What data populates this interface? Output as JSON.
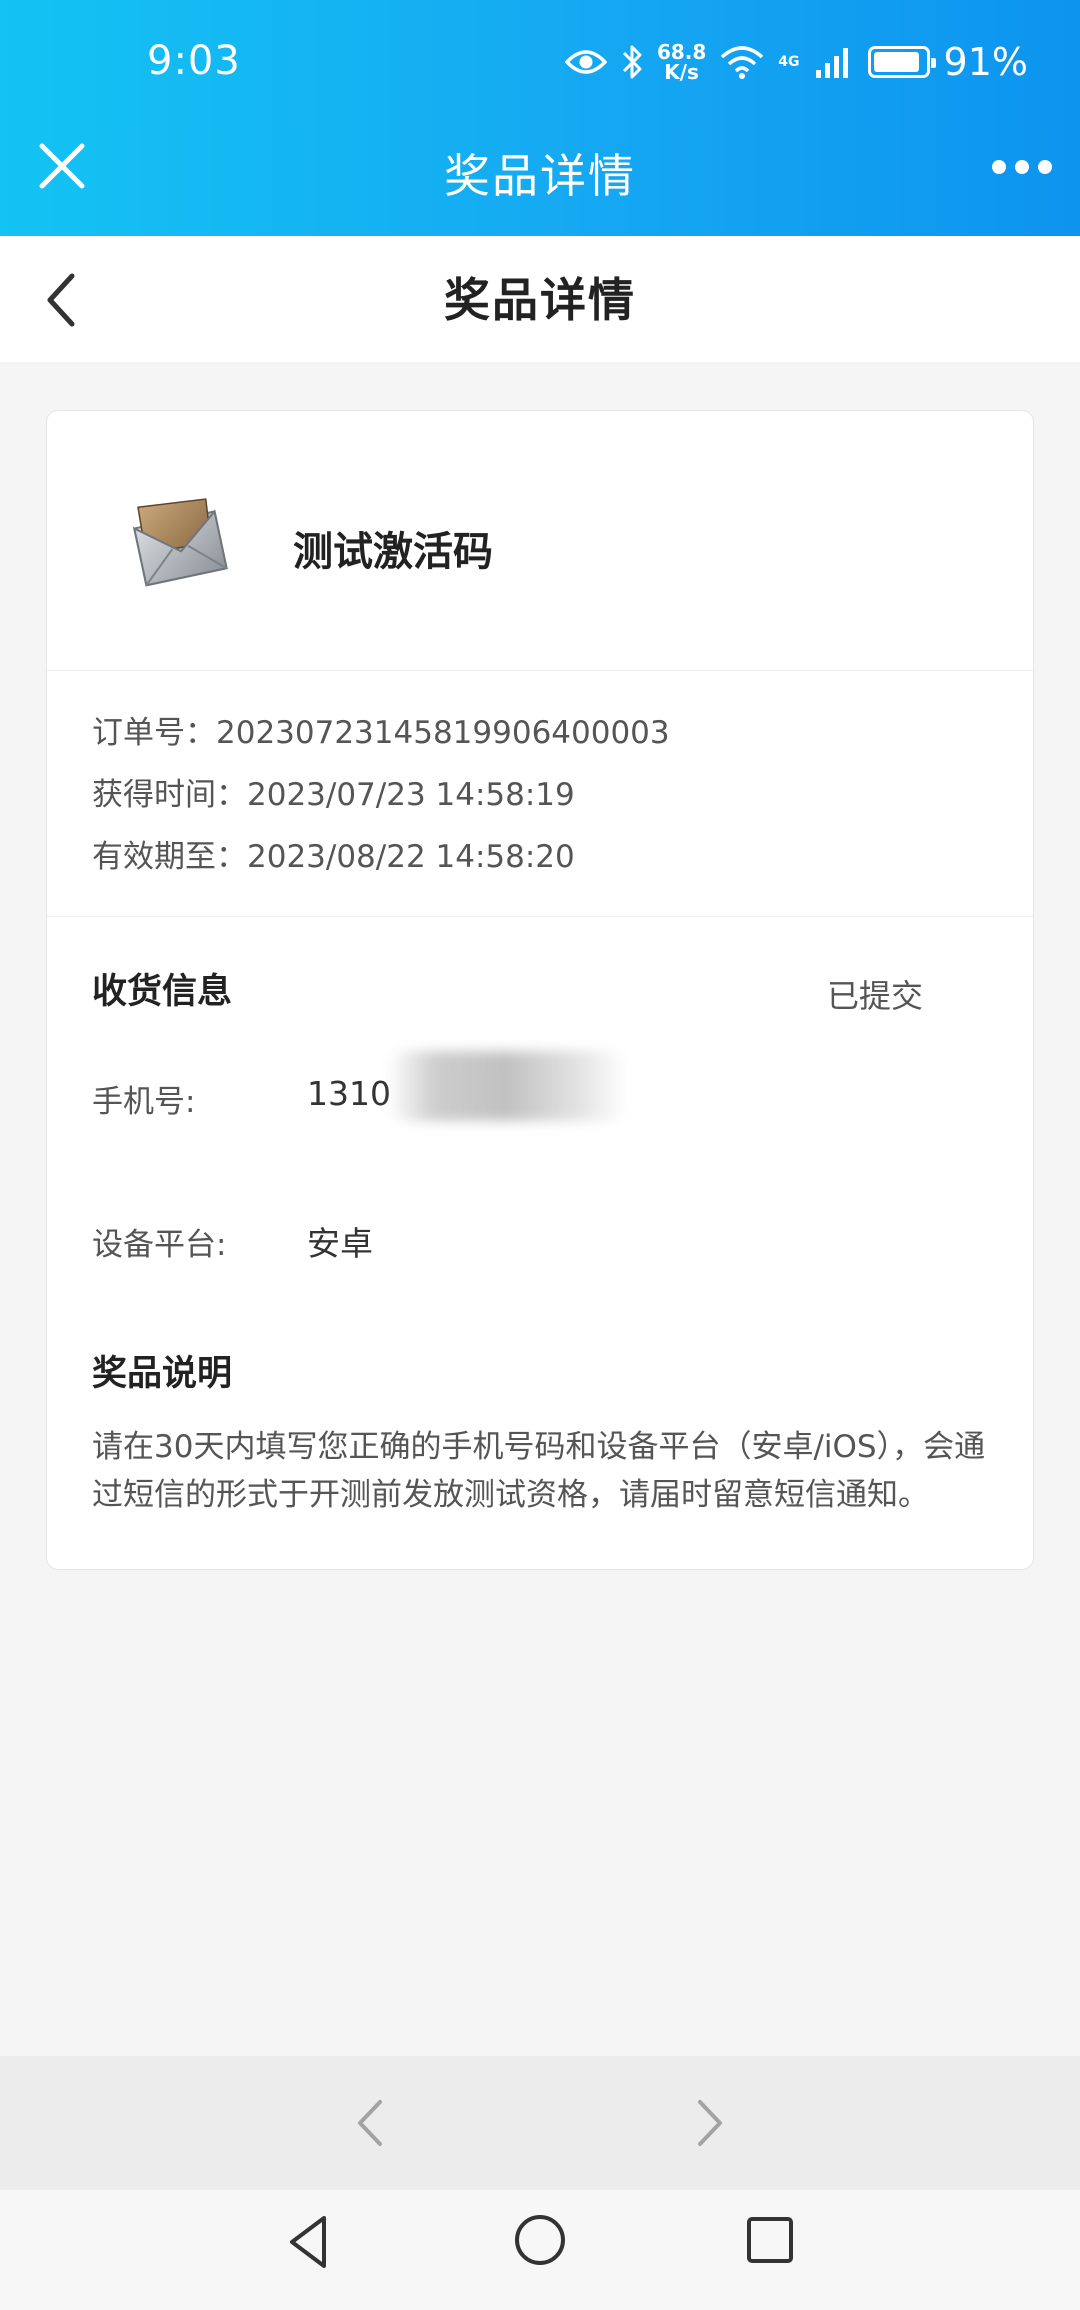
{
  "status_bar": {
    "time": "9:03",
    "net_speed_value": "68.8",
    "net_speed_unit": "K/s",
    "network_type": "4G",
    "battery_percent": "91%",
    "battery_level": 0.91
  },
  "webview_header": {
    "title": "奖品详情"
  },
  "page_header": {
    "title": "奖品详情"
  },
  "prize": {
    "name": "测试激活码",
    "icon": "envelope-icon"
  },
  "order": {
    "order_no": "订单号：20230723145819906400003",
    "obtained_time": "获得时间：2023/07/23 14:58:19",
    "valid_until": "有效期至：2023/08/22 14:58:20"
  },
  "delivery": {
    "title": "收货信息",
    "status": "已提交",
    "phone_label": "手机号:",
    "phone_value": "1310",
    "platform_label": "设备平台:",
    "platform_value": "安卓"
  },
  "description": {
    "title": "奖品说明",
    "text": "请在30天内填写您正确的手机号码和设备平台（安卓/iOS），会通过短信的形式于开测前发放测试资格，请届时留意短信通知。"
  },
  "colors": {
    "header_start": "#13c3f3",
    "header_end": "#0d94ef",
    "page_bg": "#f5f5f5"
  }
}
